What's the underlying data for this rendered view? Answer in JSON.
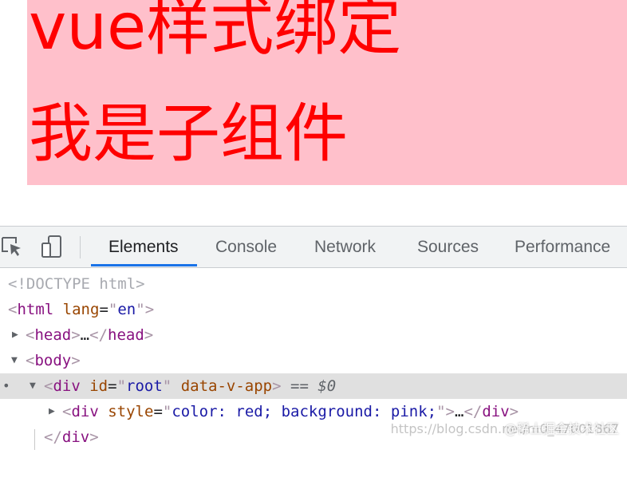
{
  "preview": {
    "title": "vue样式绑定",
    "child_text": "我是子组件",
    "text_color": "#ff0000",
    "background": "#ffc0cb"
  },
  "devtools": {
    "toolbar_icons": [
      "inspect-element-icon",
      "device-toolbar-icon"
    ],
    "tabs": [
      {
        "label": "Elements",
        "active": true
      },
      {
        "label": "Console",
        "active": false
      },
      {
        "label": "Network",
        "active": false
      },
      {
        "label": "Sources",
        "active": false
      },
      {
        "label": "Performance",
        "active": false
      }
    ],
    "accent_color": "#1a73e8",
    "dom": {
      "doctype": "<!DOCTYPE html>",
      "html": {
        "tag": "html",
        "attr": "lang",
        "value": "en"
      },
      "head": {
        "tag": "head",
        "ellipsis": "…"
      },
      "body": {
        "tag": "body"
      },
      "root": {
        "tag": "div",
        "id_attr": "id",
        "id_value": "root",
        "flag_attr": "data-v-app",
        "marker": "== $0"
      },
      "child": {
        "tag": "div",
        "attr": "style",
        "value": "color: red; background: pink;",
        "ellipsis": "…"
      },
      "close_div": "div"
    }
  },
  "watermark": {
    "url": "https://blog.csdn.net/m0_47001867",
    "site": "@稀土掘金技术社区"
  }
}
